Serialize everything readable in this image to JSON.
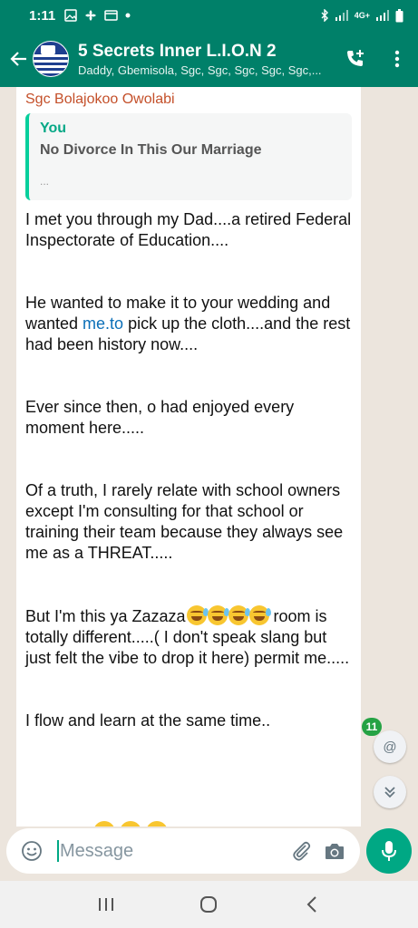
{
  "status": {
    "time": "1:11",
    "network": "4G+"
  },
  "header": {
    "title": "5 Secrets Inner L.I.O.N 2",
    "members": "Daddy, Gbemisola, Sgc, Sgc, Sgc, Sgc, Sgc,..."
  },
  "message": {
    "sender": "Sgc Bolajokoo Owolabi",
    "quote": {
      "author": "You",
      "text": "No Divorce In This Our Marriage",
      "more": "..."
    },
    "paragraphs": {
      "p1": "I met you through my Dad....a retired Federal Inspectorate of Education....",
      "p2_before": "He wanted to make it to your wedding and wanted ",
      "p2_link": "me.to",
      "p2_after": " pick up the cloth....and the rest had been history now....",
      "p3": "Ever since then, o had enjoyed every moment here.....",
      "p4": "Of a truth, I rarely relate with school owners except I'm consulting for that school or training their team because they always see me as a THREAT.....",
      "p5_before": "But I'm this ya Zazaza",
      "p5_after": " room is totally different.....( I don't speak slang but just felt the vibe to drop it here) permit me.....",
      "p6": "I flow and learn at the same time.."
    }
  },
  "floating": {
    "unread_count": "11",
    "mention_symbol": "@"
  },
  "composer": {
    "placeholder": "Message"
  },
  "colors": {
    "brand": "#008069",
    "accent": "#00a884",
    "chat_bg": "#ece5dd",
    "sender_name": "#c4502a"
  },
  "icons": {
    "back": "arrow-left-icon",
    "call": "add-call-icon",
    "menu": "more-vert-icon",
    "emoji": "emoji-icon",
    "attach": "paperclip-icon",
    "camera": "camera-icon",
    "mic": "mic-icon",
    "scroll_down": "chevron-double-down-icon"
  }
}
